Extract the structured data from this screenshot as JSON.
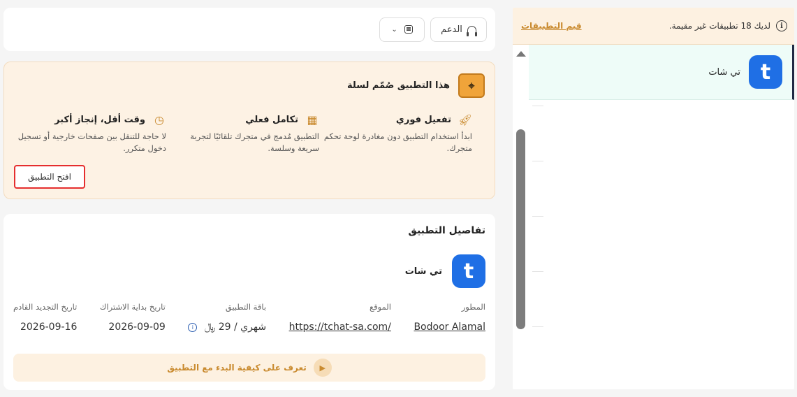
{
  "sidebar": {
    "notice": "لديك 18 تطبيقات غير مقيمة.",
    "rate_link": "قيم التطبيقات",
    "apps": [
      {
        "name": "تي شات",
        "logo_letter": "t"
      }
    ]
  },
  "topbar": {
    "support_label": "الدعم",
    "calendar_chevron": "⌄"
  },
  "promo": {
    "title": "هذا التطبيق صُمّم لسلة",
    "features": [
      {
        "title": "تفعيل فوري",
        "text": "ابدأ استخدام التطبيق دون مغادرة لوحة تحكم متجرك.",
        "icon": "rocket-icon"
      },
      {
        "title": "تكامل فعلي",
        "text": "التطبيق مُدمج في متجرك تلقائيًا لتجربة سريعة وسلسة.",
        "icon": "grid-icon"
      },
      {
        "title": "وقت أقل، إنجاز أكبر",
        "text": "لا حاجة للتنقل بين صفحات خارجية أو تسجيل دخول متكرر.",
        "icon": "clock-icon"
      }
    ],
    "open_button": "افتح التطبيق"
  },
  "details": {
    "title": "تفاصيل التطبيق",
    "app_name": "تي شات",
    "app_logo_letter": "t",
    "fields": [
      {
        "label": "المطور",
        "value": "Bodoor Alamal"
      },
      {
        "label": "الموقع",
        "value": "https://tchat-sa.com/"
      },
      {
        "label": "باقة التطبيق",
        "value": "شهري / 29 ﷼"
      },
      {
        "label": "تاريخ بداية الاشتراك",
        "value": "2026-09-09"
      },
      {
        "label": "تاريخ التجديد القادم",
        "value": "2026-09-16"
      }
    ],
    "learn_label": "تعرف على كيفية البدء مع التطبيق"
  },
  "colors": {
    "accent": "#c98a2e",
    "brand_blue": "#1f6fe5",
    "highlight_red": "#e52e2e"
  }
}
